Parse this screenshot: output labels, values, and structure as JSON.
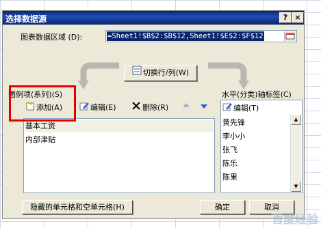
{
  "dialog": {
    "title": "选择数据源",
    "help_button": "?",
    "close_button": "×",
    "range_label": "图表数据区域",
    "range_hotkey": "(D):",
    "range_value": "=Sheet1!$B$2:$B$12,Sheet1!$E$2:$F$12",
    "switch_button": "切换行/列(W)",
    "series_heading": "图例项(系列)(S)",
    "axis_heading": "水平(分类)轴标签(C)",
    "add_button": "添加(A)",
    "edit_button": "编辑(E)",
    "delete_button": "删除(R)",
    "axis_edit_button": "编辑(T)",
    "series": [
      "基本工资",
      "内部津贴"
    ],
    "categories": [
      "黄先锋",
      "李小小",
      "张飞",
      "陈乐",
      "陈果"
    ],
    "hidden_cells_button": "隐藏的单元格和空单元格(H)",
    "ok_button": "确定",
    "cancel_button": "取消"
  },
  "watermark": "百度经验",
  "colors": {
    "title_bar": "#0a246a",
    "dialog_bg": "#ece9d8",
    "highlight": "#e00000"
  }
}
